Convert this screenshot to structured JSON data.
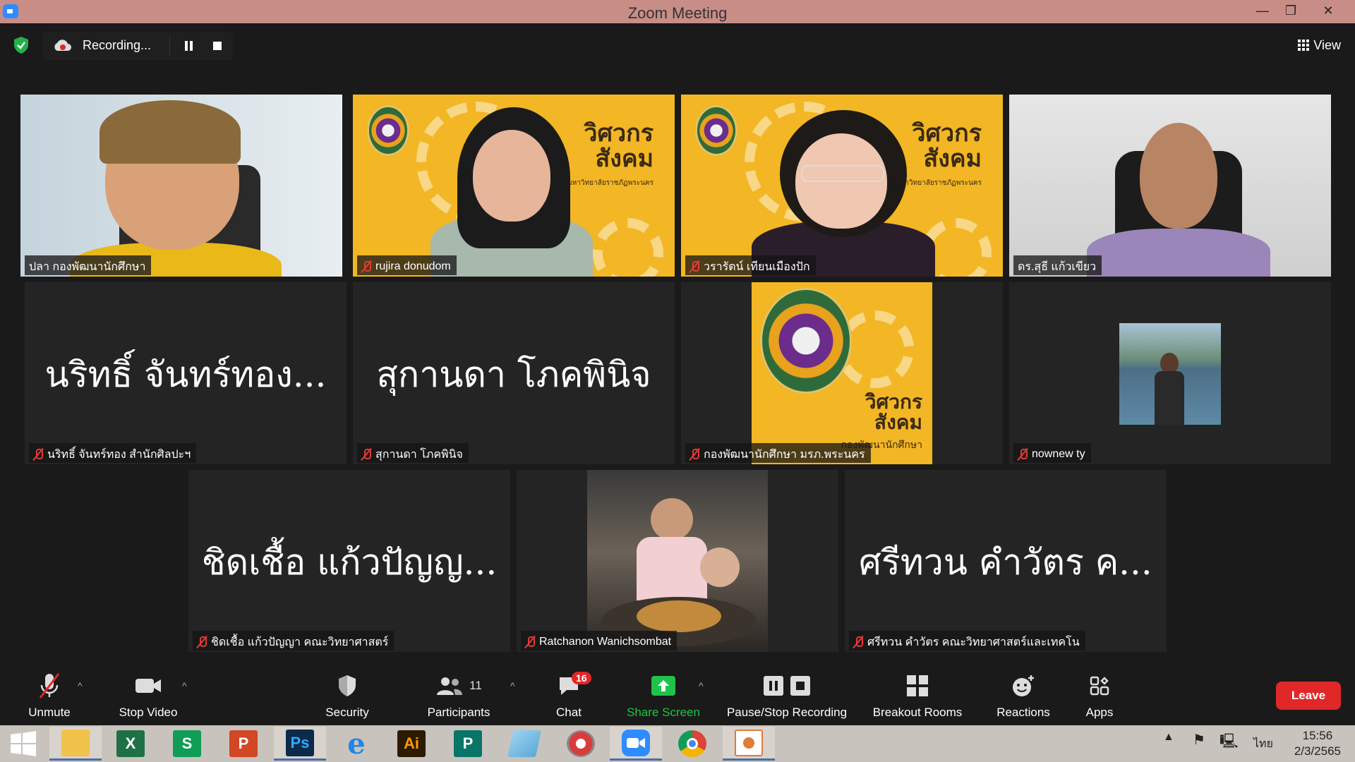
{
  "window": {
    "title": "Zoom Meeting",
    "controls": [
      "—",
      "❐",
      "✕"
    ]
  },
  "topbar": {
    "recording_label": "Recording...",
    "view_label": "View"
  },
  "participants": [
    {
      "name": "ปลา กองพัฒนานักศึกษา",
      "muted": false,
      "video": true,
      "active_speaker": true
    },
    {
      "name": "rujira donudom",
      "muted": true,
      "video": true
    },
    {
      "name": "วรารัตน์ เทียนเมืองปัก",
      "muted": true,
      "video": true
    },
    {
      "name": "ดร.สุธี  แก้วเขียว",
      "muted": false,
      "video": true
    },
    {
      "name": "นริทธิ์ จันทร์ทอง สำนักศิลปะฯ",
      "display": "นริทธิ์ จันทร์ทอง...",
      "muted": true,
      "video": false
    },
    {
      "name": "สุกานดา โภคพินิจ",
      "display": "สุกานดา โภคพินิจ",
      "muted": true,
      "video": false
    },
    {
      "name": "กองพัฒนานักศึกษา มรภ.พระนคร",
      "muted": true,
      "video": true
    },
    {
      "name": "nownew ty",
      "muted": true,
      "video": true
    },
    {
      "name": "ชิดเชื้อ  แก้วปัญญา คณะวิทยาศาสตร์",
      "display": "ชิดเชื้อ  แก้วปัญญ...",
      "muted": true,
      "video": false
    },
    {
      "name": "Ratchanon Wanichsombat",
      "muted": true,
      "video": true
    },
    {
      "name": "ศรีทวน  คำวัตร คณะวิทยาศาสตร์และเทคโน",
      "display": "ศรีทวน  คำวัตร ค...",
      "muted": true,
      "video": false
    }
  ],
  "banner": {
    "brand_line1": "วิศวกร",
    "brand_line2": "สังคม",
    "university": "มหาวิทยาลัยราชภัฏพระนคร",
    "org": "กองพัฒนานักศึกษา"
  },
  "toolbar": {
    "unmute": "Unmute",
    "stop_video": "Stop Video",
    "security": "Security",
    "participants": "Participants",
    "participants_count": "11",
    "chat": "Chat",
    "chat_badge": "16",
    "share_screen": "Share Screen",
    "pause_stop_recording": "Pause/Stop Recording",
    "breakout_rooms": "Breakout Rooms",
    "reactions": "Reactions",
    "apps": "Apps",
    "leave": "Leave"
  },
  "taskbar": {
    "apps": [
      "start",
      "file-explorer",
      "excel",
      "sway",
      "powerpoint",
      "photoshop",
      "internet-explorer",
      "illustrator",
      "publisher",
      "notes",
      "photoscape",
      "zoom",
      "chrome",
      "ms-office-lens"
    ],
    "photoshop_label": "Ps",
    "illustrator_label": "Ai",
    "language": "ไทย",
    "time": "15:56",
    "date": "2/3/2565"
  },
  "colors": {
    "titlebar": "#c98d87",
    "active_speaker": "#d7ee3d",
    "leave": "#e02828",
    "share_green": "#21c24b",
    "banner_yellow": "#f3b624"
  }
}
